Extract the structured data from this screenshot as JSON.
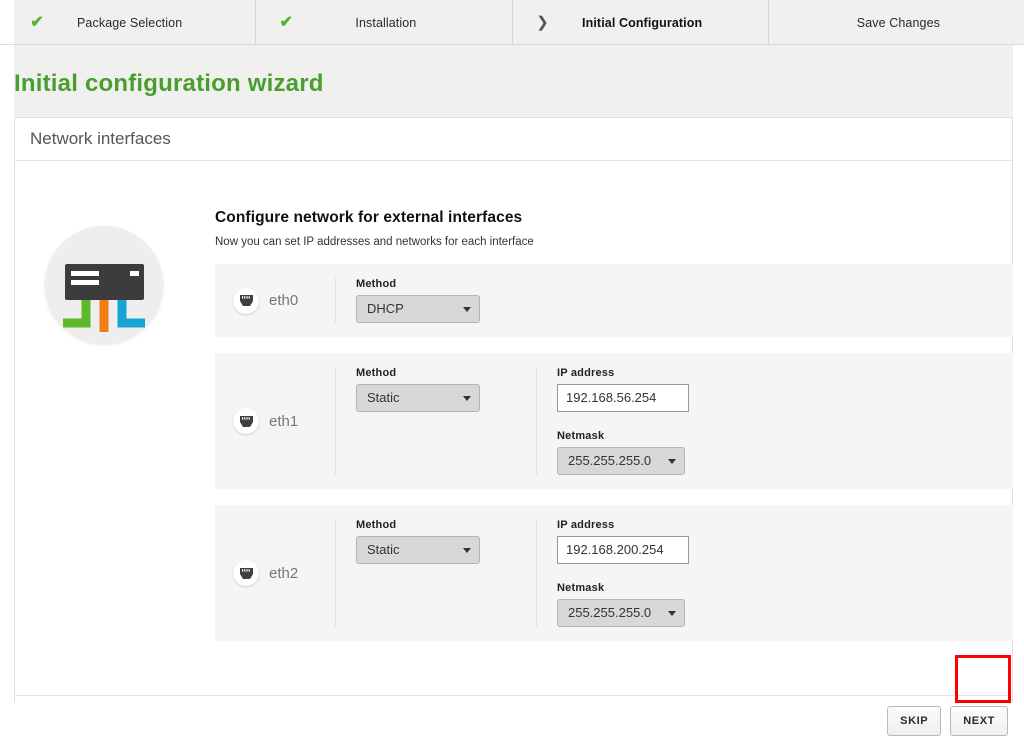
{
  "wizard": {
    "steps": [
      {
        "label": "Package Selection",
        "state": "done",
        "mark": "✔"
      },
      {
        "label": "Installation",
        "state": "done",
        "mark": "✔"
      },
      {
        "label": "Initial Configuration",
        "state": "current",
        "mark": "❯"
      },
      {
        "label": "Save Changes",
        "state": "pending",
        "mark": ""
      }
    ]
  },
  "page": {
    "title": "Initial configuration wizard",
    "title_color": "#4a9e2e"
  },
  "panel": {
    "header_title": "Network interfaces",
    "illustration": {
      "name": "network-switch-illustration",
      "circle_color": "#eeeeee",
      "device_color": "#3c3c3c",
      "cable_colors": [
        "#5fb72a",
        "#f07d12",
        "#16a5d0"
      ]
    },
    "content": {
      "heading": "Configure network for external interfaces",
      "subheading": "Now you can set IP addresses and networks for each interface"
    },
    "labels": {
      "method": "Method",
      "ip_address": "IP address",
      "netmask": "Netmask"
    },
    "interfaces": [
      {
        "name": "eth0",
        "method": "DHCP",
        "has_ip": false,
        "ip_address": "",
        "netmask": ""
      },
      {
        "name": "eth1",
        "method": "Static",
        "has_ip": true,
        "ip_address": "192.168.56.254",
        "netmask": "255.255.255.0"
      },
      {
        "name": "eth2",
        "method": "Static",
        "has_ip": true,
        "ip_address": "192.168.200.254",
        "netmask": "255.255.255.0"
      }
    ],
    "footer": {
      "skip_label": "SKIP",
      "next_label": "NEXT",
      "highlight_color": "#ff0000"
    }
  }
}
